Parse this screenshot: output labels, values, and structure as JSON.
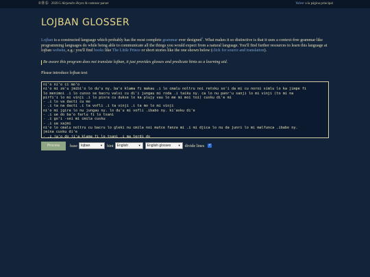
{
  "topbar": {
    "license": "©ⒷⓈ",
    "year": "2020-5",
    "author": "Alejandro Reyes",
    "credit": "& cammar parser",
    "lang_link": "Volver",
    "lang_text": "a la página principal"
  },
  "page": {
    "title": "LOJBAN GLOSSER"
  },
  "intro": {
    "lojban": "Lojban",
    "t1": " is a constructed language which probably has the most complete ",
    "grammar": "grammar",
    "t2": " ever designed",
    "sup": "1",
    "t3": ". What makes it so distinctive is that it uses a context-free grammar like programming languages do while being able to communicate all the things you would expect from a natural language. You'll find further resources to learn this language at lojban ",
    "website": "website",
    "t4": ", e.g.: you'll find ",
    "books": "books",
    "t5": " like ",
    "little_prince": "The Little Prince",
    "t6": " or short stories like the one shown below (",
    "click": "click for source and translation",
    "t7": ")."
  },
  "warning": "Be aware this program does not translate lojban, it just provides glosses and predicate hints as a learning aid.",
  "prompt": "Please introduce lojban text",
  "textarea": {
    "value": "ni'o ni'o ci mo'o\nni'o mi ze'u jmibi'o lo du'u ny. ba'o klama fi makau .i lo cmalu noltru noi retsku so'i da mi cu noroi simlu lo ka jimpe fi\nlo menimoi .i lo cunso se bacru valsi cu di'i jungau mi roda .i taiku ny. ca lo nu panr'u sanji lo mi vinji (to mi na\npirfi'i lo mi vinji .i lo pixra cu dukse lo ka plujy vau lo me mi moi toi) cusku di'e mi\n- .i lo va dacti cu mo\n- .i ta na dacti .i ta vofli .i ta vinji .i ta mo lo mi vinji\nni'o mi jgira lo nu jungau ny. lo du'u mi vofli .ibabo ny. ki'asku di'e\n- .i ue do ba'o farlu fi lo tsani\n- .i go'i -sei mi cmila cusku\n- .i ua xajmi\nni'o lo cmalu noltru cu bacru lo gleki nu cmila noi mutce fanza mi .i mi djica lo nu da junri lo mi malfunca .ibabo ny.\njmina cusku di'e\n- .i ja'o do ji'a klama fi lo tsani .i ma terdi do\nni'o mi pu'o simli lo makcu lo si..."
  },
  "controls": {
    "process_label": "Process",
    "base_label": "base",
    "base_value": "lojban",
    "hint_label": "hint",
    "hint_value": "English",
    "glosses_value": "English glosses",
    "divide_label": "divide lines",
    "divide_checked": true
  }
}
